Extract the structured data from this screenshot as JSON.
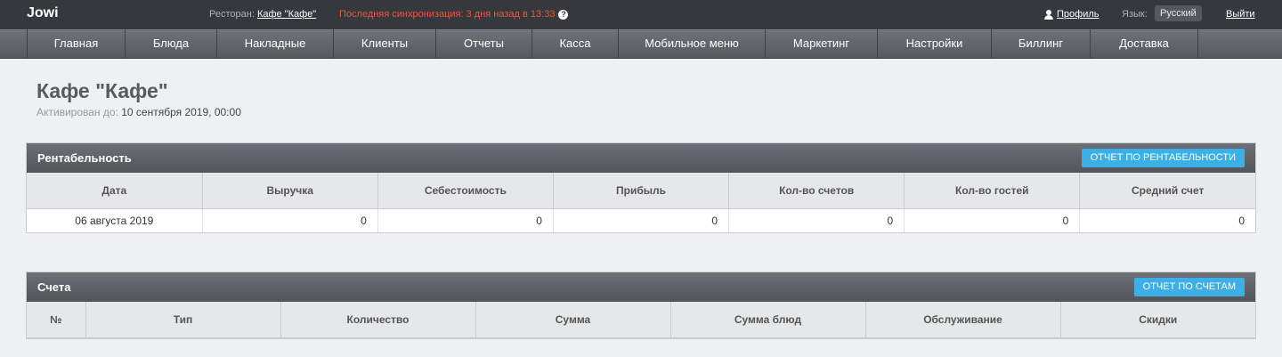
{
  "header": {
    "logo": "Jowi",
    "restaurant_label": "Ресторан:",
    "restaurant_name": "Кафе \"Кафе\"",
    "sync_text": "Последняя синхронизация: 3 дня назад в 13:33",
    "help_icon": "?",
    "profile_label": "Профиль",
    "language_label": "Язык:",
    "language_value": "Русский",
    "logout_label": "Выйти"
  },
  "nav": {
    "items": [
      "Главная",
      "Блюда",
      "Накладные",
      "Клиенты",
      "Отчеты",
      "Касса",
      "Мобильное меню",
      "Маркетинг",
      "Настройки",
      "Биллинг",
      "Доставка"
    ]
  },
  "page": {
    "title": "Кафе \"Кафе\"",
    "activated_label": "Активирован до:",
    "activated_value": "10 сентября 2019, 00:00"
  },
  "profitability": {
    "title": "Рентабельность",
    "button": "ОТЧЕТ ПО РЕНТАБЕЛЬНОСТИ",
    "columns": [
      "Дата",
      "Выручка",
      "Себестоимость",
      "Прибыль",
      "Кол-во счетов",
      "Кол-во гостей",
      "Средний счет"
    ],
    "rows": [
      [
        "06 августа 2019",
        "0",
        "0",
        "0",
        "0",
        "0",
        "0"
      ]
    ]
  },
  "bills": {
    "title": "Счета",
    "button": "ОТЧЕТ ПО СЧЕТАМ",
    "columns": [
      "№",
      "Тип",
      "Количество",
      "Сумма",
      "Сумма блюд",
      "Обслуживание",
      "Скидки"
    ]
  }
}
